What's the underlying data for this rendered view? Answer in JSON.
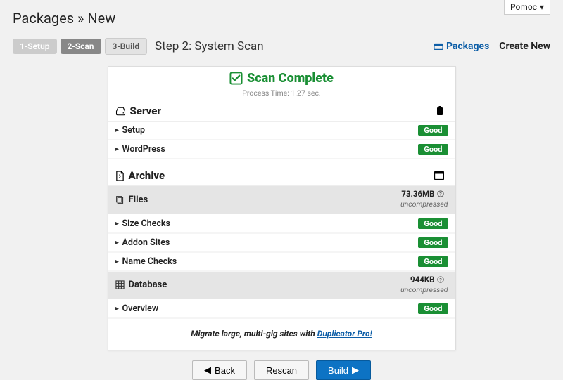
{
  "top_select": {
    "label": "Pomoc",
    "caret": "▾"
  },
  "breadcrumb": {
    "root": "Packages",
    "sep": "»",
    "leaf": "New"
  },
  "steps": {
    "setup": "1-Setup",
    "scan": "2-Scan",
    "build": "3-Build",
    "title": "Step 2: System Scan"
  },
  "nav": {
    "packages": "Packages",
    "create_new": "Create New"
  },
  "scan": {
    "title": "Scan Complete",
    "process_time": "Process Time: 1.27 sec."
  },
  "server": {
    "title": "Server",
    "rows": {
      "setup": "Setup",
      "wordpress": "WordPress"
    }
  },
  "archive": {
    "title": "Archive",
    "files": {
      "title": "Files",
      "size": "73.36MB",
      "sub": "uncompressed",
      "rows": {
        "size_checks": "Size Checks",
        "addon_sites": "Addon Sites",
        "name_checks": "Name Checks"
      }
    },
    "database": {
      "title": "Database",
      "size": "944KB",
      "sub": "uncompressed",
      "rows": {
        "overview": "Overview"
      }
    }
  },
  "badges": {
    "good": "Good"
  },
  "promo": {
    "prefix": "Migrate large, multi-gig sites with ",
    "link": "Duplicator Pro!"
  },
  "buttons": {
    "back": "Back",
    "rescan": "Rescan",
    "build": "Build"
  }
}
